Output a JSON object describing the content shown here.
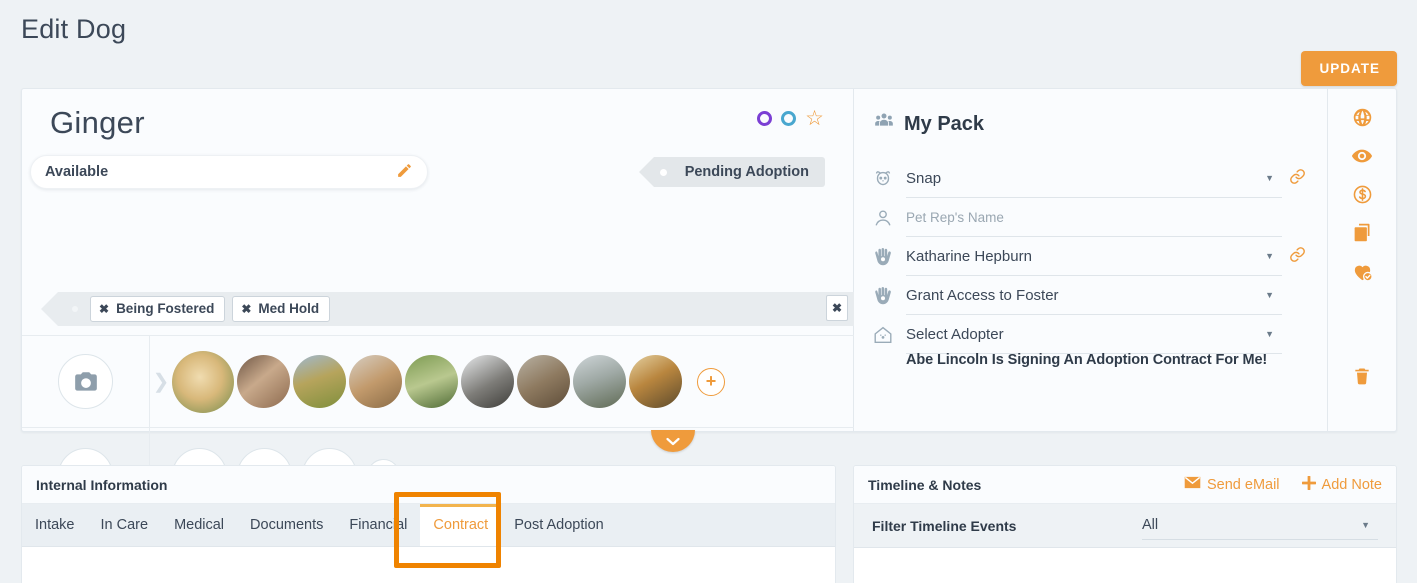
{
  "header": {
    "title": "Edit Dog",
    "update_button": "UPDATE"
  },
  "profile": {
    "name": "Ginger",
    "availability": "Available",
    "availability_edit_icon": "pencil-icon",
    "pending_tag": "Pending Adoption",
    "status_markers": [
      "purple-ring-icon",
      "blue-ring-icon",
      "star-outline-icon"
    ],
    "tags": [
      {
        "label": "Being Fostered",
        "remove": "✖"
      },
      {
        "label": "Med Hold",
        "remove": "✖"
      }
    ],
    "tag_strip_close": "✖",
    "photo_row_icon": "camera-icon",
    "video_row_icon": "video-play-icon",
    "photo_add": "+",
    "video_add": "+",
    "photo_count": 9,
    "video_count": 3,
    "collapse_icon": "chevron-down-icon"
  },
  "my_pack": {
    "title": "My Pack",
    "title_icon": "people-group-icon",
    "rows": [
      {
        "icon": "dog-face-icon",
        "value": "Snap",
        "placeholder": "",
        "has_caret": true,
        "has_link": true
      },
      {
        "icon": "person-icon",
        "value": "",
        "placeholder": "Pet Rep's Name",
        "has_caret": false,
        "has_link": false
      },
      {
        "icon": "hands-pet-icon",
        "value": "Katharine Hepburn",
        "placeholder": "",
        "has_caret": true,
        "has_link": true
      },
      {
        "icon": "hands-pet-icon",
        "value": "Grant Access to Foster",
        "placeholder": "",
        "has_caret": true,
        "has_link": false
      },
      {
        "icon": "home-paw-icon",
        "value": "Select Adopter",
        "placeholder": "",
        "has_caret": true,
        "has_link": false
      }
    ],
    "note": "Abe Lincoln Is Signing An Adoption Contract For Me!"
  },
  "rail": {
    "icons": [
      "globe-icon",
      "eye-icon",
      "dollar-circle-icon",
      "copy-icon",
      "heart-check-icon"
    ],
    "trash": "trash-icon"
  },
  "internal_information": {
    "title": "Internal Information",
    "tabs": [
      {
        "label": "Intake",
        "active": false
      },
      {
        "label": "In Care",
        "active": false
      },
      {
        "label": "Medical",
        "active": false
      },
      {
        "label": "Documents",
        "active": false
      },
      {
        "label": "Financial",
        "active": false
      },
      {
        "label": "Contract",
        "active": true
      },
      {
        "label": "Post Adoption",
        "active": false
      }
    ]
  },
  "timeline": {
    "title": "Timeline & Notes",
    "send_email": "Send eMail",
    "send_email_icon": "envelope-icon",
    "add_note": "Add Note",
    "add_note_icon": "plus-icon",
    "filter_label": "Filter Timeline Events",
    "filter_value": "All",
    "filter_caret": "chevron-down-icon"
  },
  "colors": {
    "accent_orange": "#ef9b3c",
    "annotation_orange": "#ef8300",
    "page_bg": "#eef2f5",
    "text_dark": "#3c4858",
    "ring_purple": "#7b3fd4",
    "ring_blue": "#49a7cf"
  }
}
